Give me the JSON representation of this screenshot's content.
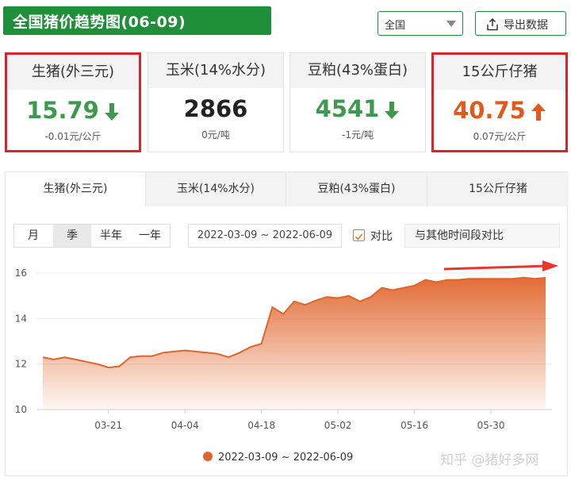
{
  "header": {
    "title": "全国猪价趋势图(06-09)",
    "region": "全国",
    "export_label": "导出数据"
  },
  "cards": [
    {
      "name": "生猪(外三元)",
      "price": "15.79",
      "trend": "down",
      "change": "-0.01元/公斤"
    },
    {
      "name": "玉米(14%水分)",
      "price": "2866",
      "trend": "flat",
      "change": "0元/吨"
    },
    {
      "name": "豆粕(43%蛋白)",
      "price": "4541",
      "trend": "down",
      "change": "-1元/吨"
    },
    {
      "name": "15公斤仔猪",
      "price": "40.75",
      "trend": "up",
      "change": "0.07元/公斤"
    }
  ],
  "colors": {
    "green": "#1f8f3a",
    "up": "#e05a1c",
    "down": "#3c9a4f",
    "series": "#e0652b",
    "highlight": "#d9232d"
  },
  "tabs": [
    "生猪(外三元)",
    "玉米(14%水分)",
    "豆粕(43%蛋白)",
    "15公斤仔猪"
  ],
  "periods": [
    "月",
    "季",
    "半年",
    "一年"
  ],
  "active_period": "季",
  "date_range": "2022-03-09 ~ 2022-06-09",
  "compare_label": "对比",
  "compare_placeholder": "与其他时间段对比",
  "watermark": "知乎 @猪好多网",
  "chart_data": {
    "type": "area",
    "series": [
      {
        "name": "2022-03-09 ~ 2022-06-09",
        "x": [
          "2022-03-09",
          "2022-03-11",
          "2022-03-13",
          "2022-03-15",
          "2022-03-17",
          "2022-03-19",
          "2022-03-21",
          "2022-03-23",
          "2022-03-25",
          "2022-03-27",
          "2022-03-29",
          "2022-03-31",
          "2022-04-02",
          "2022-04-04",
          "2022-04-06",
          "2022-04-08",
          "2022-04-10",
          "2022-04-12",
          "2022-04-14",
          "2022-04-16",
          "2022-04-18",
          "2022-04-20",
          "2022-04-22",
          "2022-04-24",
          "2022-04-26",
          "2022-04-28",
          "2022-04-30",
          "2022-05-02",
          "2022-05-04",
          "2022-05-06",
          "2022-05-08",
          "2022-05-10",
          "2022-05-12",
          "2022-05-14",
          "2022-05-16",
          "2022-05-18",
          "2022-05-20",
          "2022-05-22",
          "2022-05-24",
          "2022-05-26",
          "2022-05-28",
          "2022-05-30",
          "2022-06-01",
          "2022-06-03",
          "2022-06-05",
          "2022-06-07",
          "2022-06-09"
        ],
        "values": [
          12.3,
          12.2,
          12.3,
          12.2,
          12.1,
          12.0,
          11.85,
          11.9,
          12.3,
          12.35,
          12.35,
          12.5,
          12.55,
          12.6,
          12.55,
          12.5,
          12.45,
          12.3,
          12.5,
          12.75,
          12.9,
          14.5,
          14.2,
          14.75,
          14.6,
          14.8,
          14.95,
          14.9,
          15.0,
          14.75,
          14.95,
          15.35,
          15.25,
          15.35,
          15.45,
          15.7,
          15.6,
          15.7,
          15.7,
          15.75,
          15.75,
          15.75,
          15.75,
          15.75,
          15.8,
          15.75,
          15.79
        ]
      }
    ],
    "xticks": [
      "03-21",
      "04-04",
      "04-18",
      "05-02",
      "05-16",
      "05-30"
    ],
    "ylim": [
      10,
      16
    ],
    "yticks": [
      10,
      12,
      14,
      16
    ],
    "grid": true,
    "legend": "bottom-center"
  }
}
